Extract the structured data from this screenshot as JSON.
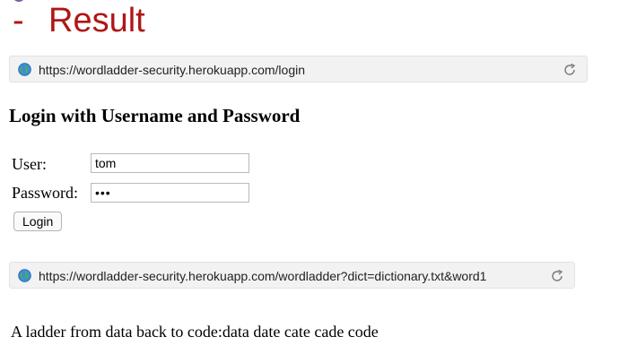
{
  "slide": {
    "bullet": "-",
    "title": "Result",
    "title_color": "#b01616"
  },
  "browser_top": {
    "url": "https://wordladder-security.herokuapp.com/login",
    "icons": [
      "globe-icon",
      "reload-icon"
    ]
  },
  "login_page": {
    "heading": "Login with Username and Password",
    "user_label": "User:",
    "user_value": "tom",
    "password_label": "Password:",
    "password_value": "•••",
    "login_button": "Login"
  },
  "browser_bottom": {
    "url": "https://wordladder-security.herokuapp.com/wordladder?dict=dictionary.txt&word1",
    "icons": [
      "globe-icon",
      "reload-icon"
    ]
  },
  "result_page": {
    "text": "A ladder from data back to code:data date cate cade code"
  }
}
